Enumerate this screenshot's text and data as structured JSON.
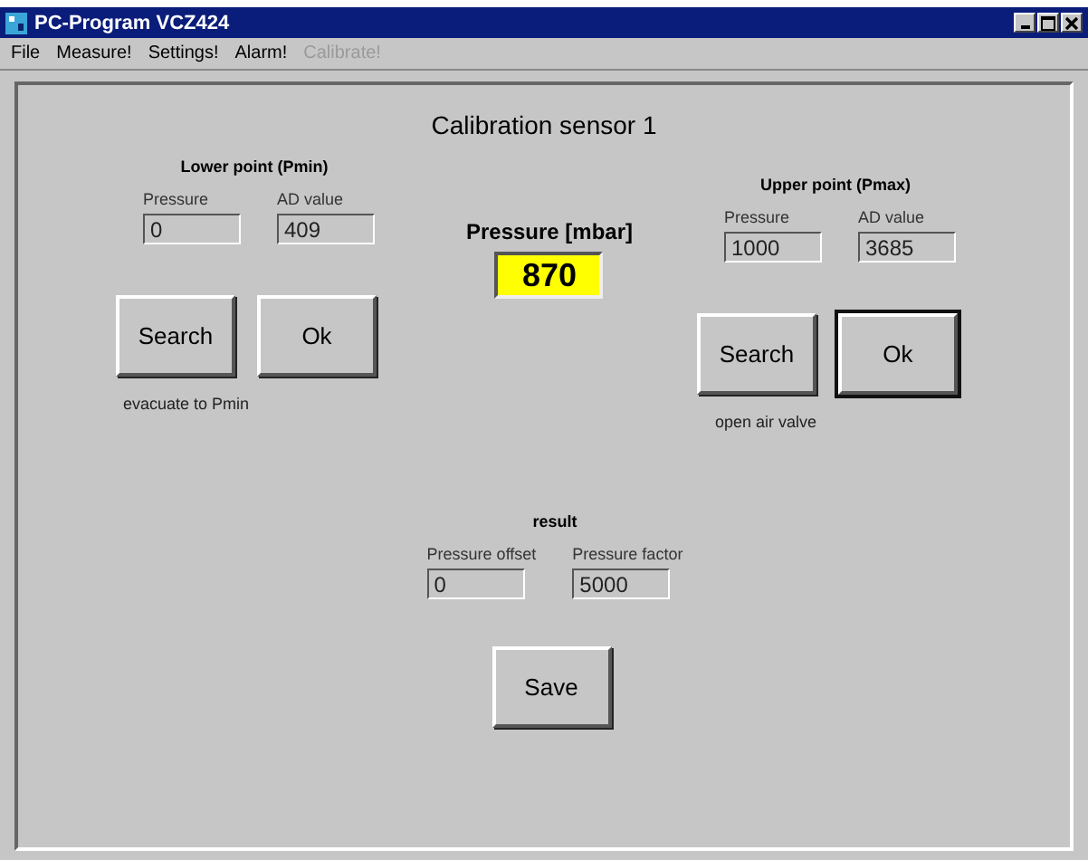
{
  "window": {
    "title": "PC-Program VCZ424"
  },
  "menu": [
    {
      "label": "File",
      "disabled": false
    },
    {
      "label": "Measure!",
      "disabled": false
    },
    {
      "label": "Settings!",
      "disabled": false
    },
    {
      "label": "Alarm!",
      "disabled": false
    },
    {
      "label": "Calibrate!",
      "disabled": true
    }
  ],
  "heading": "Calibration sensor 1",
  "lower": {
    "title": "Lower point (Pmin)",
    "fields": [
      {
        "label": "Pressure",
        "value": "0"
      },
      {
        "label": "AD value",
        "value": "409"
      }
    ],
    "buttons": [
      {
        "label": "Search",
        "default": false
      },
      {
        "label": "Ok",
        "default": false
      }
    ],
    "caption": "evacuate to Pmin"
  },
  "reading": {
    "label": "Pressure [mbar]",
    "value": "870"
  },
  "upper": {
    "title": "Upper point (Pmax)",
    "fields": [
      {
        "label": "Pressure",
        "value": "1000"
      },
      {
        "label": "AD value",
        "value": "3685"
      }
    ],
    "buttons": [
      {
        "label": "Search",
        "default": false
      },
      {
        "label": "Ok",
        "default": true
      }
    ],
    "caption": "open air valve"
  },
  "result": {
    "title": "result",
    "fields": [
      {
        "label": "Pressure offset",
        "value": "0"
      },
      {
        "label": "Pressure factor",
        "value": "5000"
      }
    ]
  },
  "save": {
    "label": "Save",
    "default": false
  }
}
